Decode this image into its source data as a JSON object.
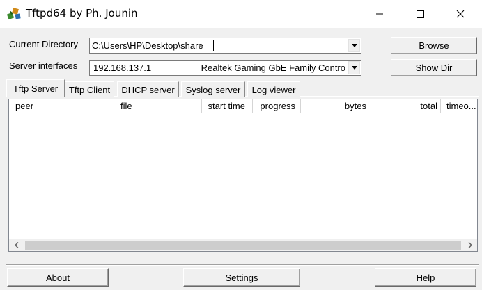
{
  "window": {
    "title": "Tftpd64 by Ph. Jounin",
    "icon": "tftpd-app-icon",
    "controls": [
      "minimize-icon",
      "maximize-icon",
      "close-icon"
    ]
  },
  "current_directory": {
    "label": "Current Directory",
    "value": "C:\\Users\\HP\\Desktop\\share",
    "browse_label": "Browse"
  },
  "server_interfaces": {
    "label": "Server interfaces",
    "ip": "192.168.137.1",
    "adapter": "Realtek Gaming GbE Family Contro",
    "showdir_label": "Show Dir"
  },
  "tabs": [
    {
      "label": "Tftp Server",
      "active": true
    },
    {
      "label": "Tftp Client",
      "active": false
    },
    {
      "label": "DHCP server",
      "active": false
    },
    {
      "label": "Syslog server",
      "active": false
    },
    {
      "label": "Log viewer",
      "active": false
    }
  ],
  "table": {
    "columns": [
      "peer",
      "file",
      "start time",
      "progress",
      "bytes",
      "total",
      "timeo..."
    ],
    "rows": []
  },
  "footer": {
    "about_label": "About",
    "settings_label": "Settings",
    "help_label": "Help"
  }
}
